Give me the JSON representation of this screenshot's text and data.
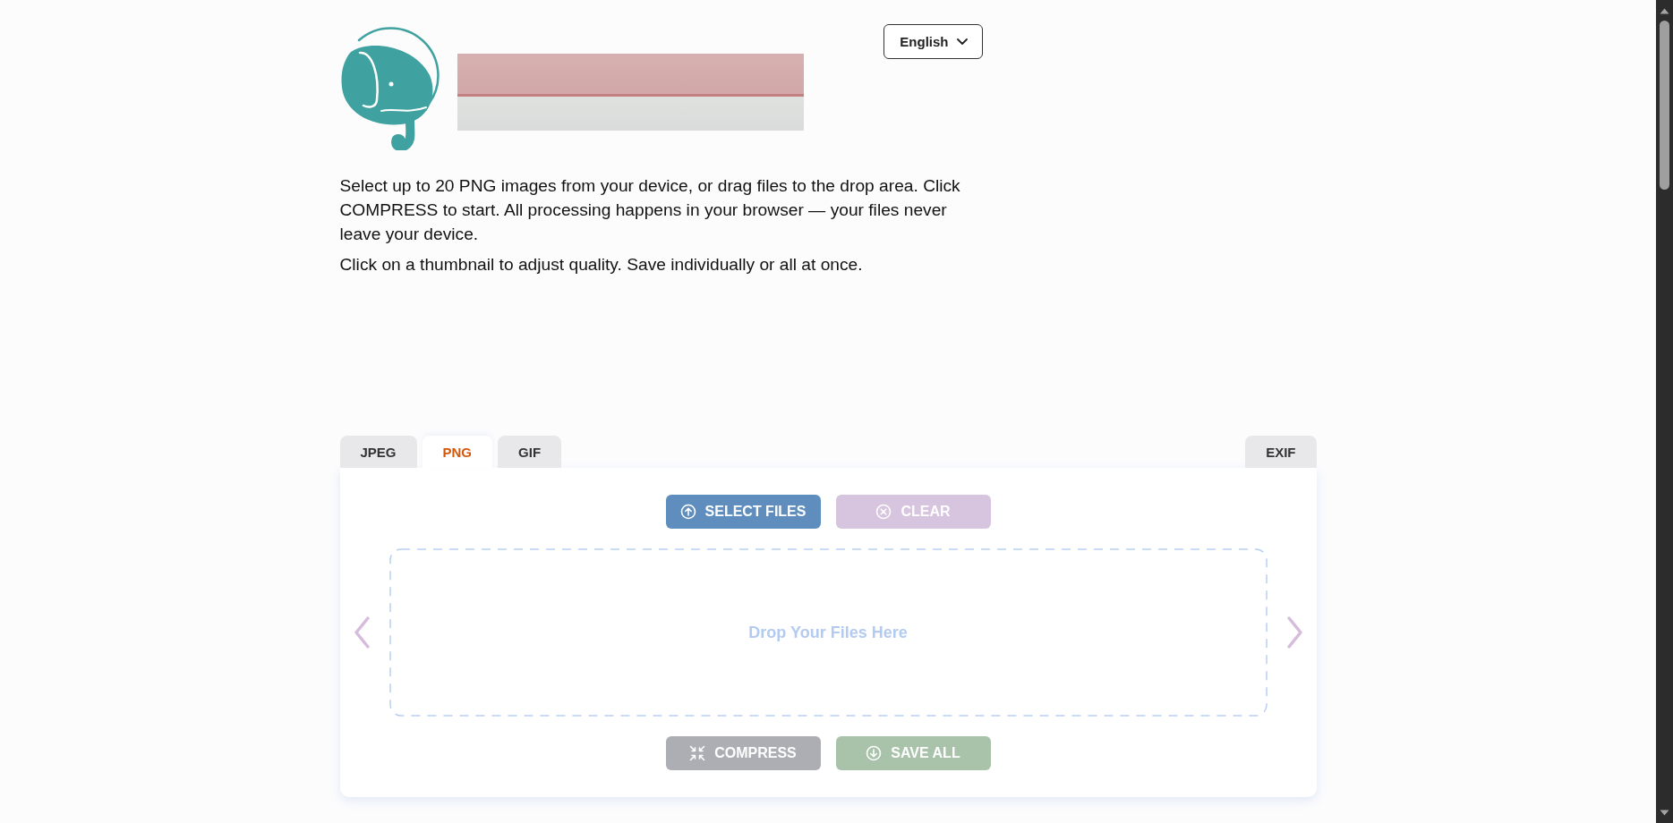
{
  "header": {
    "language_selector": {
      "label": "English"
    }
  },
  "intro": [
    "Select up to 20 PNG images from your device, or drag files to the drop area. Click COMPRESS to start. All processing happens in your browser — your files never leave your device.",
    "Click on a thumbnail to adjust quality. Save individually or all at once."
  ],
  "tabs": [
    {
      "label": "JPEG",
      "selected": false
    },
    {
      "label": "PNG",
      "selected": true
    },
    {
      "label": "GIF",
      "selected": false
    }
  ],
  "right_tabs": [
    {
      "label": "EXIF",
      "selected": false
    }
  ],
  "top_buttons": [
    {
      "kind": "select",
      "label": "SELECT FILES",
      "disabled": false
    },
    {
      "kind": "clear",
      "label": "CLEAR",
      "disabled": true
    }
  ],
  "drop_area": {
    "text": "Drop Your Files Here"
  },
  "bottom_buttons": [
    {
      "kind": "compress",
      "label": "COMPRESS",
      "disabled": true
    },
    {
      "kind": "save",
      "label": "SAVE ALL",
      "disabled": true
    }
  ]
}
